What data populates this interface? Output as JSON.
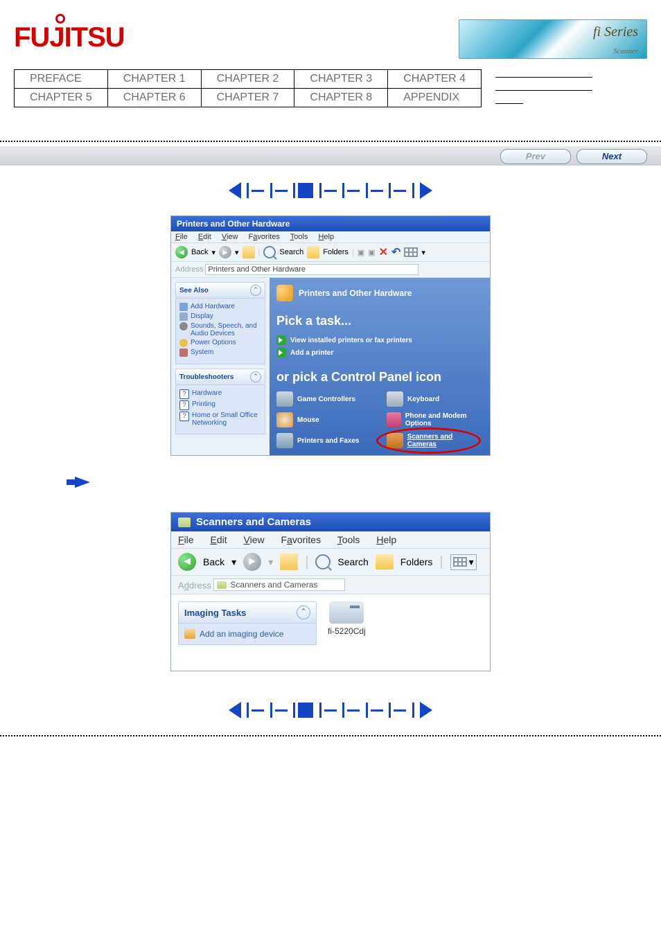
{
  "brand": "FUJITSU",
  "fi_badge": {
    "title": "fi Series",
    "sub": "Scanner"
  },
  "nav": {
    "r1": [
      "PREFACE",
      "CHAPTER 1",
      "CHAPTER 2",
      "CHAPTER 3",
      "CHAPTER 4"
    ],
    "r2": [
      "CHAPTER 5",
      "CHAPTER 6",
      "CHAPTER 7",
      "CHAPTER 8",
      "APPENDIX"
    ]
  },
  "prevnext": {
    "prev": "Prev",
    "next": "Next"
  },
  "win1": {
    "title": "Printers and Other Hardware",
    "menu": {
      "file": "File",
      "edit": "Edit",
      "view": "View",
      "favorites": "Favorites",
      "tools": "Tools",
      "help": "Help"
    },
    "toolbar": {
      "back": "Back",
      "search": "Search",
      "folders": "Folders"
    },
    "address_label": "Address",
    "address_value": "Printers and Other Hardware",
    "see_also": {
      "head": "See Also",
      "items": [
        "Add Hardware",
        "Display",
        "Sounds, Speech, and Audio Devices",
        "Power Options",
        "System"
      ]
    },
    "troubleshooters": {
      "head": "Troubleshooters",
      "items": [
        "Hardware",
        "Printing",
        "Home or Small Office Networking"
      ]
    },
    "main": {
      "header": "Printers and Other Hardware",
      "pick": "Pick a task...",
      "task1": "View installed printers or fax printers",
      "task2": "Add a printer",
      "or_pick": "or pick a Control Panel icon",
      "icons": {
        "game": "Game Controllers",
        "keyboard": "Keyboard",
        "mouse": "Mouse",
        "phone": "Phone and Modem Options",
        "printers": "Printers and Faxes",
        "scanners": "Scanners and Cameras"
      }
    }
  },
  "win2": {
    "title": "Scanners and Cameras",
    "menu": {
      "file": "File",
      "edit": "Edit",
      "view": "View",
      "favorites": "Favorites",
      "tools": "Tools",
      "help": "Help"
    },
    "toolbar": {
      "back": "Back",
      "search": "Search",
      "folders": "Folders"
    },
    "address_label": "Address",
    "address_value": "Scanners and Cameras",
    "imaging": {
      "head": "Imaging Tasks",
      "add": "Add an imaging device"
    },
    "device": "fi-5220Cdj"
  }
}
